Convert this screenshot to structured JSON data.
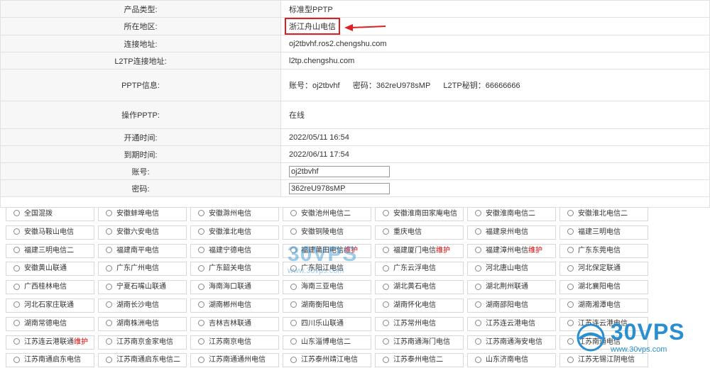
{
  "info": {
    "product_type": {
      "label": "产品类型:",
      "value": "标准型PPTP"
    },
    "region": {
      "label": "所在地区:",
      "value": "浙江舟山电信"
    },
    "host": {
      "label": "连接地址:",
      "value": "oj2tbvhf.ros2.chengshu.com"
    },
    "l2tp_host": {
      "label": "L2TP连接地址:",
      "value": "l2tp.chengshu.com"
    },
    "pptp_info": {
      "label": "PPTP信息:",
      "value": "账号：oj2tbvhf      密码：362reU978sMP      L2TP秘钥：66666666"
    },
    "operate": {
      "label": "操作PPTP:",
      "value": "在线"
    },
    "open_time": {
      "label": "开通时间:",
      "value": "2022/05/11 16:54"
    },
    "expire_time": {
      "label": "到期时间:",
      "value": "2022/06/11 17:54"
    },
    "account": {
      "label": "账号:",
      "value": "oj2tbvhf"
    },
    "password": {
      "label": "密码:",
      "value": "362reU978sMP"
    }
  },
  "watermark": {
    "brand": "30VPS",
    "url": "www.30vps.com"
  },
  "regions": [
    [
      "全国混拨",
      "安徽蚌埠电信",
      "安徽滁州电信",
      "安徽池州电信二",
      "安徽淮南田家庵电信",
      "安徽淮南电信二",
      "安徽淮北电信二"
    ],
    [
      "安徽马鞍山电信",
      "安徽六安电信",
      "安徽淮北电信",
      "安徽铜陵电信",
      "重庆电信",
      "福建泉州电信",
      "福建三明电信"
    ],
    [
      "福建三明电信二",
      "福建南平电信",
      "福建宁德电信",
      "福建莆田电信",
      "福建厦门电信",
      "福建漳州电信",
      "广东东莞电信"
    ],
    [
      "安徽黄山联通",
      "广东广州电信",
      "广东韶关电信",
      "广东阳江电信",
      "广东云浮电信",
      "河北唐山电信",
      "河北保定联通"
    ],
    [
      "广西桂林电信",
      "宁夏石嘴山联通",
      "海南海口联通",
      "海南三亚电信",
      "湖北黄石电信",
      "湖北荆州联通",
      "湖北襄阳电信"
    ],
    [
      "河北石家庄联通",
      "湖南长沙电信",
      "湖南郴州电信",
      "湖南衡阳电信",
      "湖南怀化电信",
      "湖南邵阳电信",
      "湖南湘潭电信"
    ],
    [
      "湖南常德电信",
      "湖南株洲电信",
      "吉林吉林联通",
      "四川乐山联通",
      "江苏常州电信",
      "江苏连云港电信",
      "江苏连云港电信"
    ],
    [
      "江苏连云港联通",
      "江苏南京金家电信",
      "江苏南京电信",
      "山东淄博电信二",
      "江苏南通海门电信",
      "江苏南通海安电信",
      "江苏南通电信"
    ],
    [
      "江苏南通启东电信",
      "江苏南通启东电信二",
      "江苏南通通州电信",
      "江苏泰州靖江电信",
      "江苏泰州电信二",
      "山东济南电信",
      "江苏无锡江阴电信"
    ]
  ],
  "maintenance_label": "维护",
  "maintenance": [
    "2-3",
    "2-4",
    "2-5",
    "7-0"
  ]
}
